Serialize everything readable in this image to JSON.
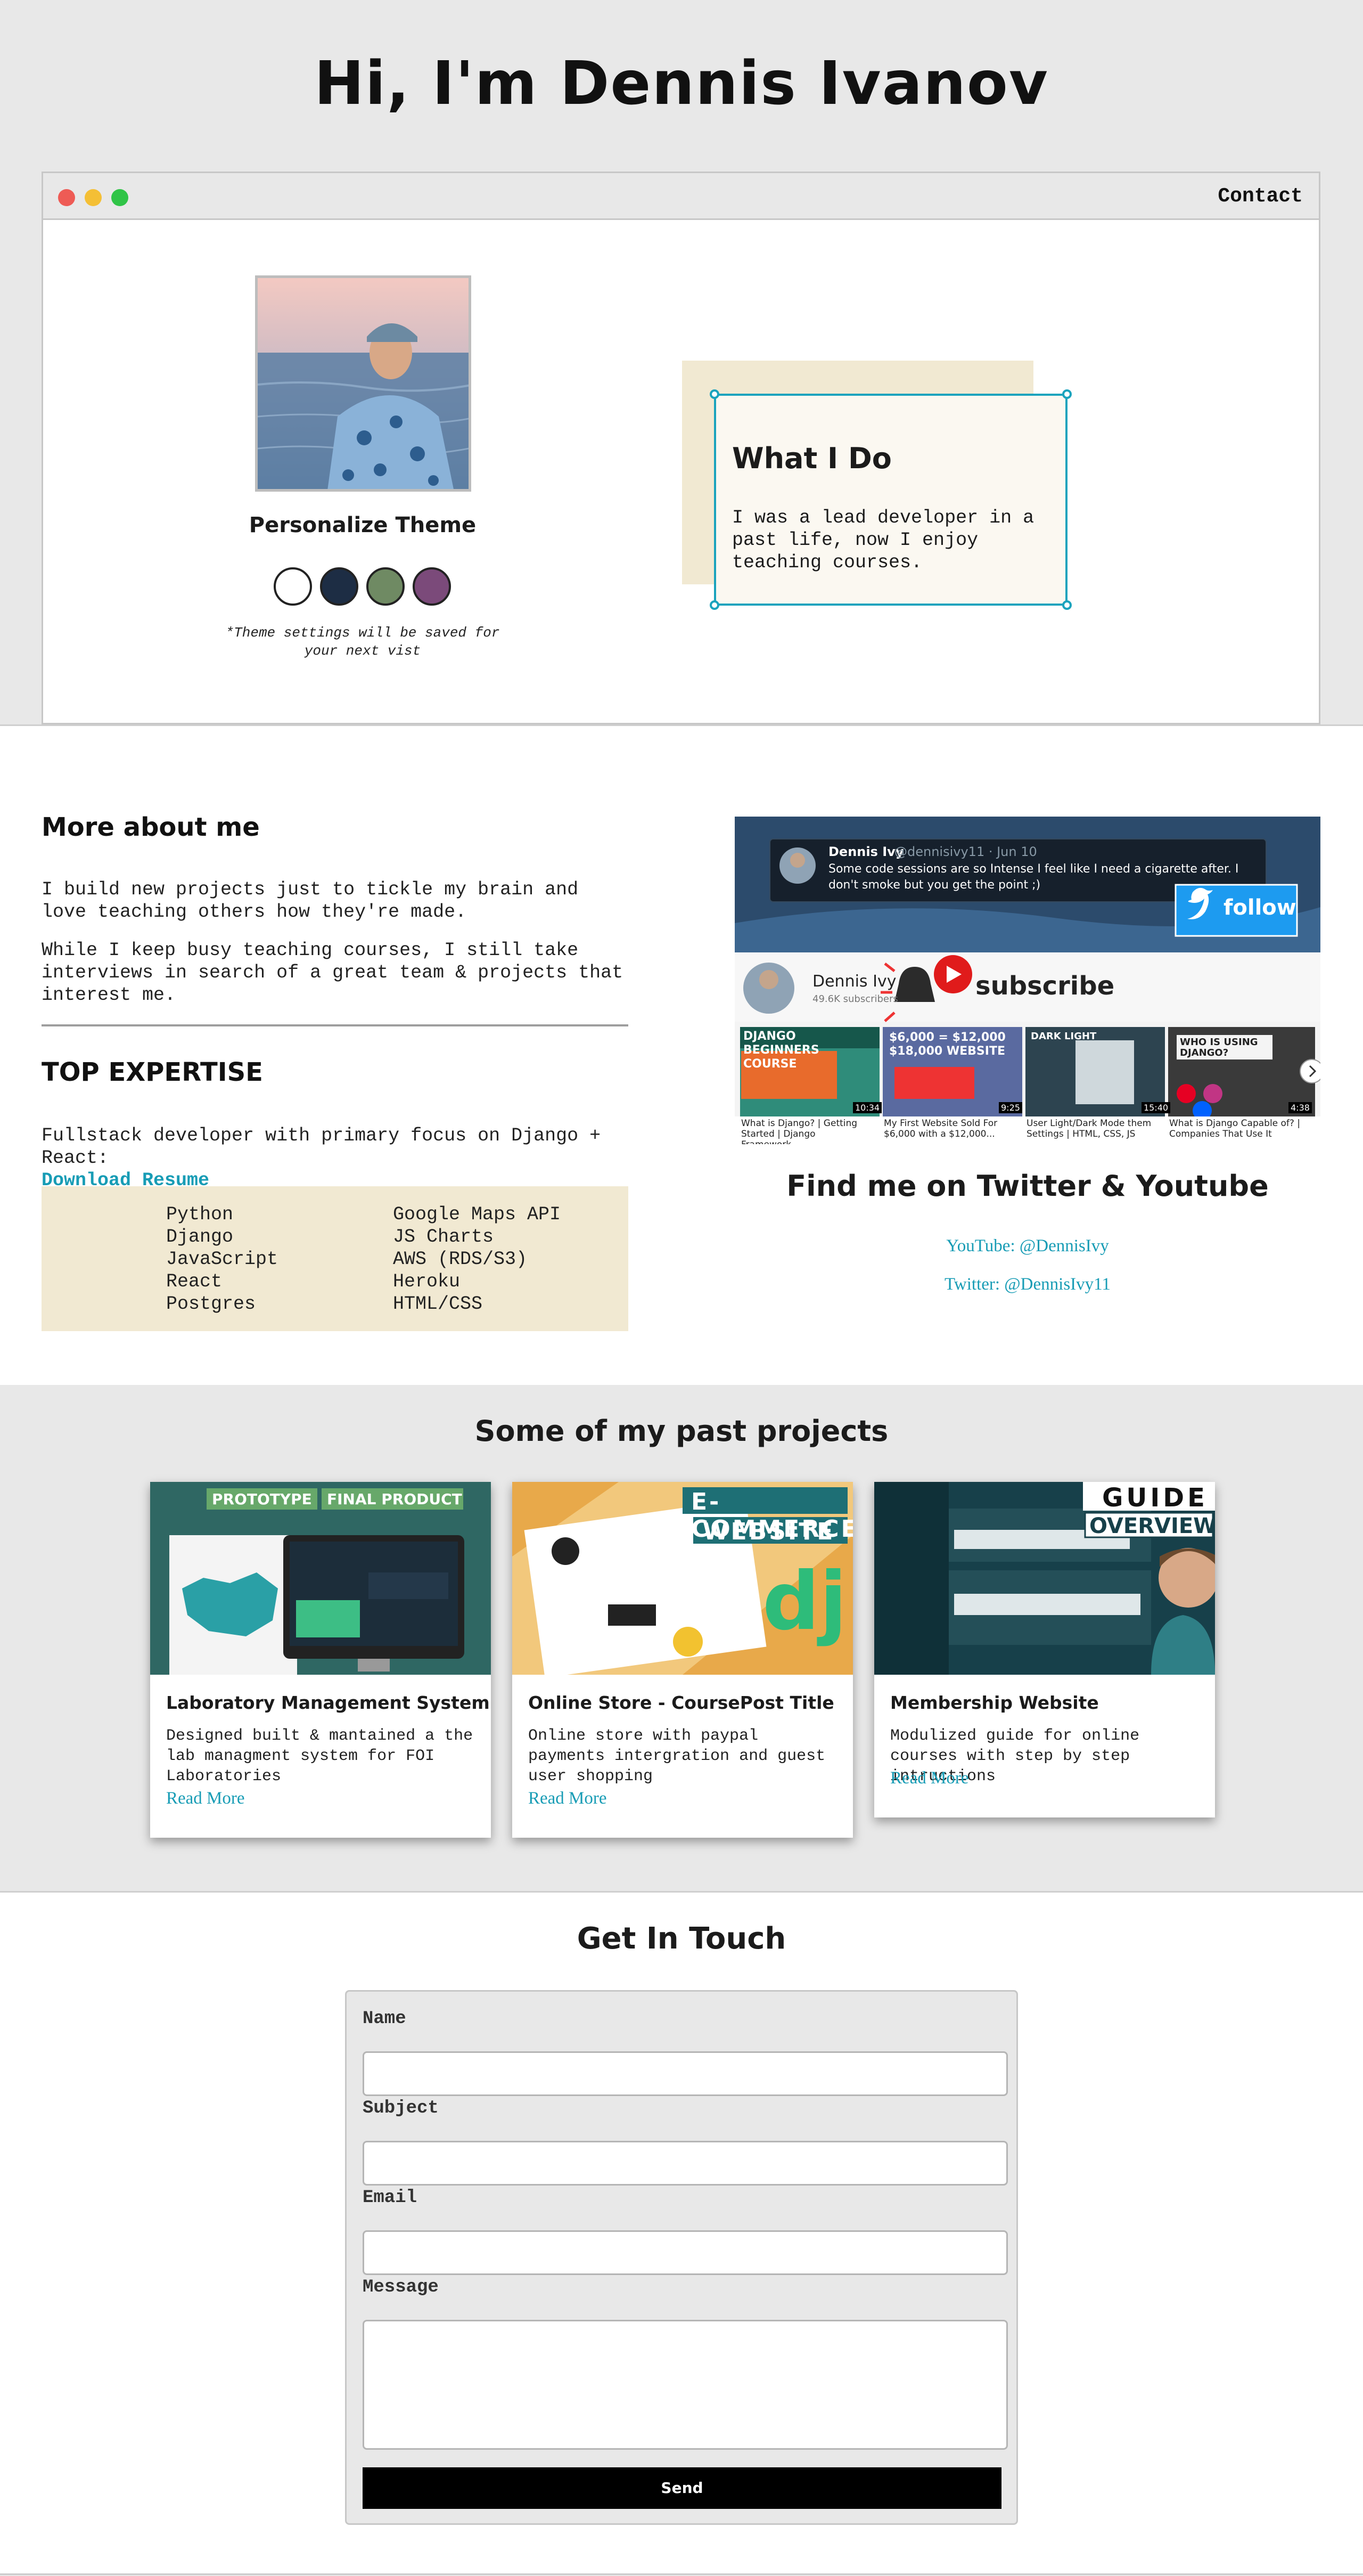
{
  "hero": {
    "title": "Hi, I'm Dennis Ivanov"
  },
  "browser": {
    "nav_link": "Contact",
    "dots": [
      "#ee5b55",
      "#f4bf35",
      "#30c447"
    ]
  },
  "profile": {
    "theme_title": "Personalize Theme",
    "theme_colors": [
      "#ffffff",
      "#1d2d44",
      "#6f8a63",
      "#7b4a7a"
    ],
    "theme_note": "*Theme settings will be saved for your next vist"
  },
  "what_i_do": {
    "title": "What I Do",
    "text": "I was a lead developer in a past life, now I enjoy teaching courses."
  },
  "about": {
    "title": "More about me",
    "p1": "I build new projects just to tickle my brain and love teaching others how they're made.",
    "p2": "While I keep busy teaching courses, I still take interviews in search of a great team & projects that interest me.",
    "expertise_title": "TOP EXPERTISE",
    "expertise_text": "Fullstack developer with primary focus on Django + React:",
    "resume_link": "Download Resume",
    "skills_left": [
      "Python",
      "Django",
      "JavaScript",
      "React",
      "Postgres"
    ],
    "skills_right": [
      "Google Maps API",
      "JS Charts",
      "AWS (RDS/S3)",
      "Heroku",
      "HTML/CSS"
    ]
  },
  "social": {
    "tweet_name": "Dennis Ivy",
    "tweet_handle": "@dennisivy11 · Jun 10",
    "tweet_text": "Some code sessions are so Intense I feel like I need a cigarette after. I don't smoke but you get the point ;)",
    "follow_label": "follow",
    "yt_name": "Dennis Ivy",
    "yt_subs": "49.6K subscribers",
    "subscribe_label": "subscribe",
    "videos": [
      {
        "caption": "What is Django? | Getting Started | Django Framework...",
        "time": "10:34",
        "thumb_text": "DJANGO BEGINNERS COURSE"
      },
      {
        "caption": "My First Website Sold For $6,000 with a $12,000...",
        "time": "9:25",
        "thumb_text": "$6,000 = $12,000 $18,000 WEBSITE"
      },
      {
        "caption": "User Light/Dark Mode them Settings | HTML, CSS, JS",
        "time": "15:40",
        "thumb_text": "DARK LIGHT"
      },
      {
        "caption": "What is Django Capable of? | Companies That Use It",
        "time": "4:38",
        "thumb_text": "WHO IS USING DJANGO?"
      }
    ],
    "title": "Find me on Twitter & Youtube",
    "youtube": "YouTube: @DennisIvy",
    "twitter": "Twitter: @DennisIvy11"
  },
  "projects": {
    "title": "Some of my past projects",
    "items": [
      {
        "title": "Laboratory Management System",
        "text": "Designed built & mantained a the lab managment system for FOI Laboratories",
        "link": "Read More",
        "img_labels": [
          "PROTOTYPE",
          "FINAL PRODUCT"
        ]
      },
      {
        "title": "Online Store - CoursePost Title",
        "text": "Online store with paypal payments intergration and guest user shopping",
        "link": "Read More",
        "img_labels": [
          "E-COMMERCE",
          "WEBSITE",
          "dj"
        ]
      },
      {
        "title": "Membership Website",
        "text": "Modulized guide for online courses with step by step intructions",
        "link": "Read More",
        "img_labels": [
          "GUIDE",
          "OVERVIEW"
        ]
      }
    ]
  },
  "contact": {
    "title": "Get In Touch",
    "name_label": "Name",
    "subject_label": "Subject",
    "email_label": "Email",
    "message_label": "Message",
    "send_label": "Send"
  }
}
